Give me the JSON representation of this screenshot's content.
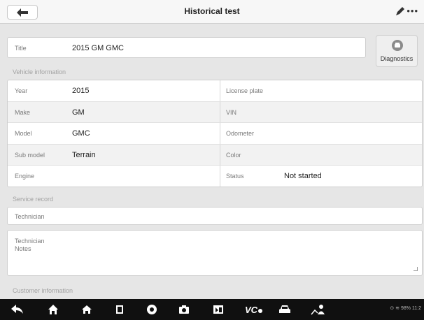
{
  "header": {
    "title": "Historical test"
  },
  "title_field": {
    "label": "Title",
    "value": "2015 GM GMC"
  },
  "diagnostics_button": {
    "label": "Diagnostics"
  },
  "sections": {
    "vehicle": "Vehicle information",
    "service": "Service record",
    "customer": "Customer information"
  },
  "vehicle_rows": [
    {
      "left_label": "Year",
      "left_value": "2015",
      "right_label": "License plate",
      "right_value": ""
    },
    {
      "left_label": "Make",
      "left_value": "GM",
      "right_label": "VIN",
      "right_value": ""
    },
    {
      "left_label": "Model",
      "left_value": "GMC",
      "right_label": "Odometer",
      "right_value": ""
    },
    {
      "left_label": "Sub model",
      "left_value": "Terrain",
      "right_label": "Color",
      "right_value": ""
    },
    {
      "left_label": "Engine",
      "left_value": "",
      "right_label": "Status",
      "right_value": "Not started"
    }
  ],
  "service": {
    "technician_label": "Technician",
    "notes_label_line1": "Technician",
    "notes_label_line2": "Notes"
  },
  "navbar": {
    "icons": [
      "back-icon",
      "home-icon",
      "house-icon",
      "recent-apps-icon",
      "browser-icon",
      "camera-icon",
      "screen-capture-icon",
      "vci-icon",
      "car-icon",
      "remote-support-icon"
    ],
    "status_text": "98% 11:2"
  },
  "colors": {
    "titlebar": "#f7f7f7",
    "background": "#e6e6e6",
    "navbar": "#101010"
  }
}
